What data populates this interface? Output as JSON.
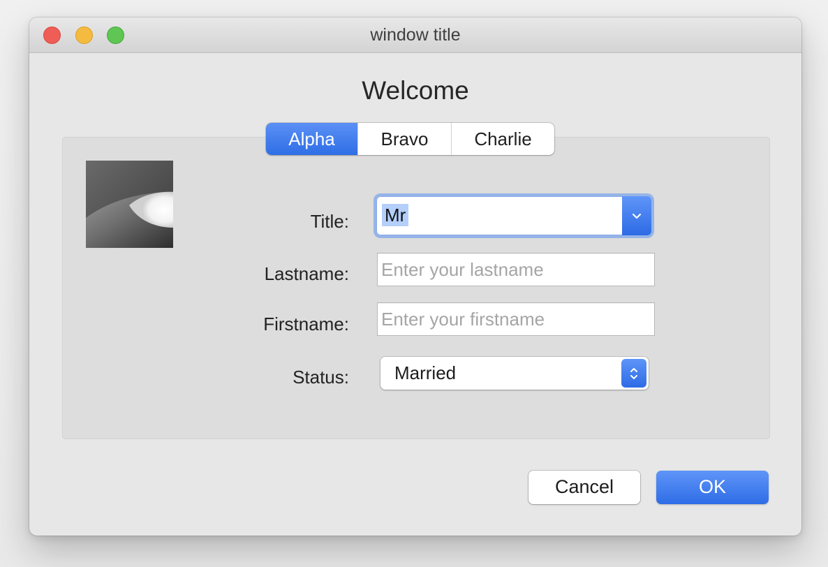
{
  "window": {
    "title": "window title"
  },
  "heading": "Welcome",
  "tabs": [
    {
      "label": "Alpha",
      "selected": true
    },
    {
      "label": "Bravo",
      "selected": false
    },
    {
      "label": "Charlie",
      "selected": false
    }
  ],
  "form": {
    "title_label": "Title:",
    "title_value": "Mr",
    "lastname_label": "Lastname:",
    "lastname_value": "",
    "lastname_placeholder": "Enter your lastname",
    "firstname_label": "Firstname:",
    "firstname_value": "",
    "firstname_placeholder": "Enter your firstname",
    "status_label": "Status:",
    "status_value": "Married"
  },
  "buttons": {
    "cancel": "Cancel",
    "ok": "OK"
  },
  "colors": {
    "accent": "#2f6ee6",
    "close": "#ee5e57",
    "minimize": "#f4bb40",
    "maximize": "#5fc653"
  }
}
